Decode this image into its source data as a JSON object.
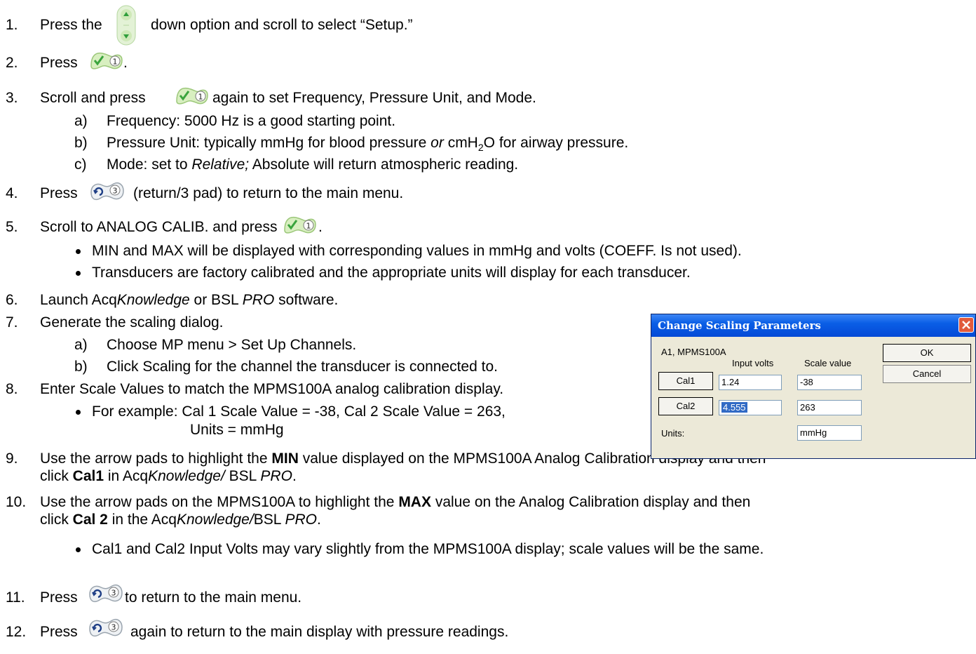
{
  "steps": {
    "s1": {
      "num": "1.",
      "pre": "Press the",
      "post": "down option and scroll to select “Setup.”"
    },
    "s2": {
      "num": "2.",
      "pre": "Press",
      "post": "."
    },
    "s3": {
      "num": "3.",
      "pre": "Scroll and press",
      "post": "again to set Frequency, Pressure Unit, and Mode.",
      "a": {
        "label": "a)",
        "text": "Frequency: 5000 Hz is a good starting point."
      },
      "b": {
        "label": "b)",
        "t1": "Pressure Unit: typically mmHg for blood pressure ",
        "t2": "or",
        "t3": " cmH",
        "sub": "2",
        "t4": "O for airway pressure."
      },
      "c": {
        "label": "c)",
        "t1": "Mode: set to ",
        "t2": "Relative;",
        "t3": " Absolute will return atmospheric reading."
      }
    },
    "s4": {
      "num": "4.",
      "pre": "Press",
      "post": "(return/3 pad) to return to the main menu."
    },
    "s5": {
      "num": "5.",
      "pre": "Scroll to ANALOG CALIB. and press",
      "post": ".",
      "bullet1": "MIN and MAX will be displayed with corresponding values in mmHg and volts (COEFF. Is not used).",
      "bullet2": "Transducers are factory calibrated and the appropriate units will display for each transducer."
    },
    "s6": {
      "num": "6.",
      "t1": "Launch Acq",
      "t2": "Knowledge",
      "t3": " or BSL ",
      "t4": "PRO",
      "t5": " software."
    },
    "s7": {
      "num": "7.",
      "text": "Generate the scaling dialog.",
      "a": {
        "label": "a)",
        "text": "Choose MP menu > Set Up Channels."
      },
      "b": {
        "label": "b)",
        "text": "Click Scaling for the channel the transducer is connected to."
      }
    },
    "s8": {
      "num": "8.",
      "text": "Enter Scale Values to match the MPMS100A analog calibration display.",
      "bullet": "For example: Cal 1 Scale Value = -38, Cal 2 Scale Value = 263,",
      "bullet_cont": "Units = mmHg"
    },
    "s9": {
      "num": "9.",
      "t1": "Use the arrow pads to highlight the ",
      "t2": "MIN",
      "t3": " value displayed on the MPMS100A Analog Calibration display and then",
      "l2a": "click ",
      "l2b": "Cal1",
      "l2c": " in Acq",
      "l2d": "Knowledge/",
      "l2e": " BSL ",
      "l2f": "PRO",
      "l2g": "."
    },
    "s10": {
      "num": "10.",
      "t1": "Use the arrow pads on the MPMS100A to highlight the ",
      "t2": "MAX",
      "t3": " value on the Analog Calibration display and then",
      "l2a": "click ",
      "l2b": "Cal 2",
      "l2c": " in the Acq",
      "l2d": "Knowledge/",
      "l2e": "BSL ",
      "l2f": "PRO",
      "l2g": ".",
      "bullet": "Cal1 and Cal2 Input Volts may vary slightly from the MPMS100A display; scale values will be the same."
    },
    "s11": {
      "num": "11.",
      "pre": "Press",
      "post": "to return to the main menu."
    },
    "s12": {
      "num": "12.",
      "pre": "Press",
      "post": "again to return to the main display with pressure readings."
    }
  },
  "dialog": {
    "title": "Change Scaling Parameters",
    "channel": "A1, MPMS100A",
    "col_input": "Input volts",
    "col_scale": "Scale value",
    "cal1_label": "Cal1",
    "cal1_input": "1.24",
    "cal1_scale": "-38",
    "cal2_label": "Cal2",
    "cal2_input": "4.555",
    "cal2_scale": "263",
    "units_label": "Units:",
    "units_value": "mmHg",
    "ok_label": "OK",
    "cancel_label": "Cancel"
  },
  "icons": {
    "scroll": "scroll-pad-icon",
    "ok": "ok-1-pad-icon",
    "return": "return-3-pad-icon",
    "close": "close-icon"
  },
  "colors": {
    "pad_green": "#c6e6a4",
    "pad_arrow": "#2f9e3a",
    "title_bar": "#0a5ee6",
    "selection": "#316ac5"
  }
}
